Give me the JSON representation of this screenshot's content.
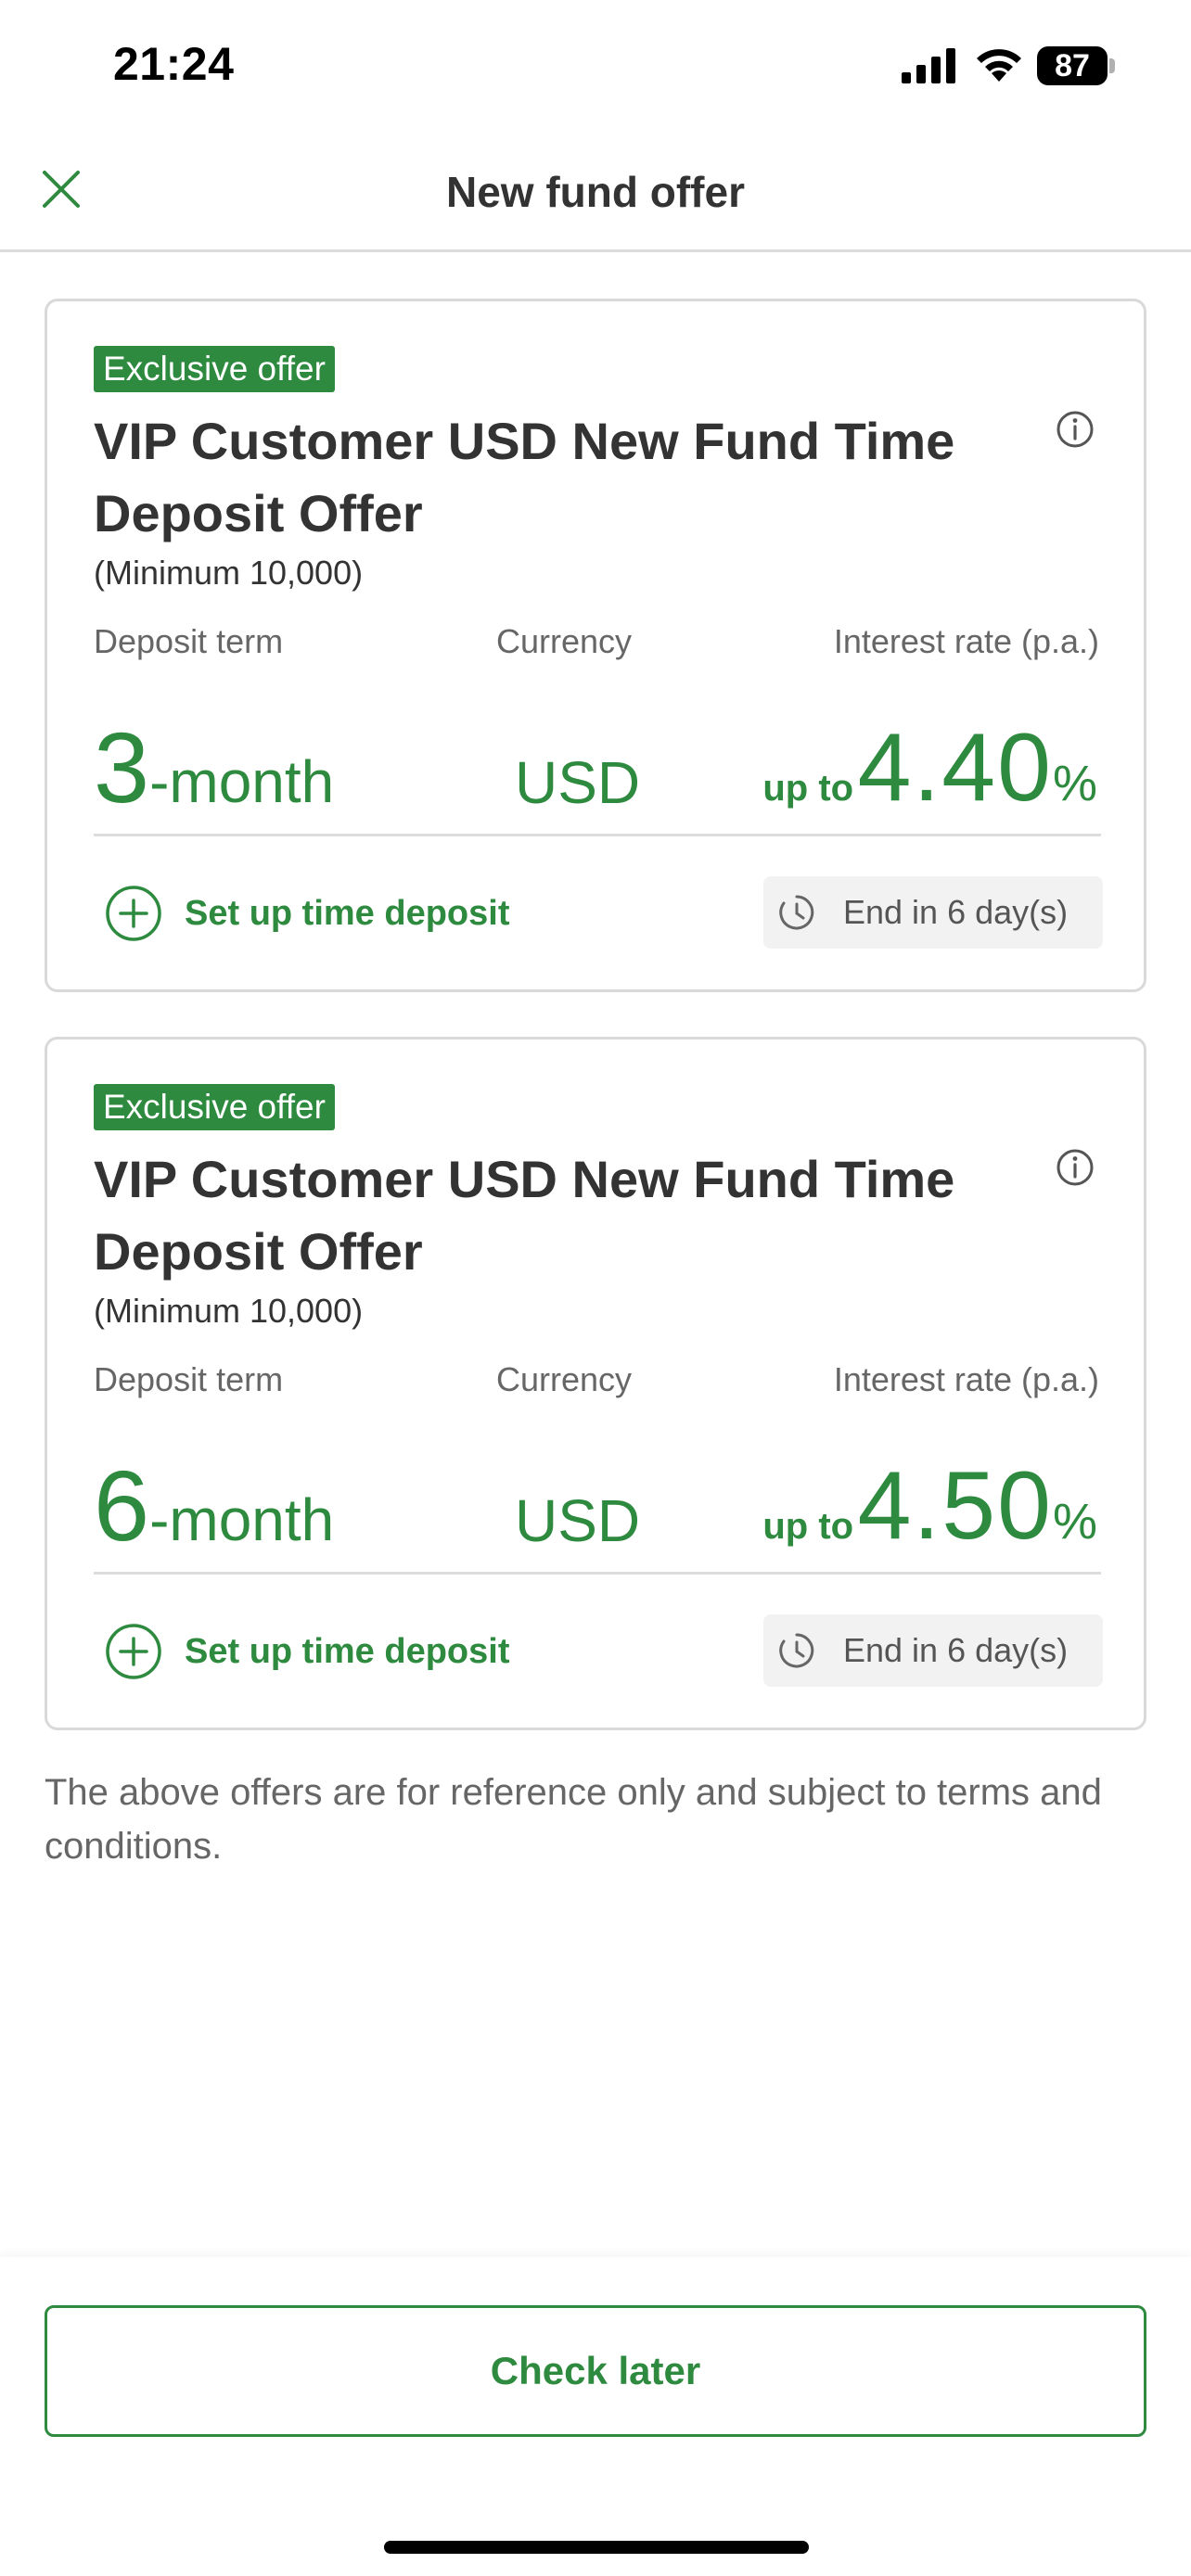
{
  "status_bar": {
    "time": "21:24",
    "battery": "87",
    "icons": [
      "signal-icon",
      "wifi-icon",
      "battery-icon"
    ]
  },
  "header": {
    "title": "New fund offer",
    "close_icon": "close-icon"
  },
  "offers": [
    {
      "badge": "Exclusive offer",
      "title": "VIP Customer USD New Fund Time Deposit Offer",
      "minimum": "(Minimum 10,000)",
      "labels": {
        "term": "Deposit term",
        "currency": "Currency",
        "rate": "Interest rate (p.a.)"
      },
      "term_number": "3",
      "term_unit": "-month",
      "currency": "USD",
      "rate_prefix": "up to",
      "rate": "4.40",
      "rate_suffix": "%",
      "action": "Set up time deposit",
      "end_text": "End in 6 day(s)"
    },
    {
      "badge": "Exclusive offer",
      "title": "VIP Customer USD New Fund Time Deposit Offer",
      "minimum": "(Minimum 10,000)",
      "labels": {
        "term": "Deposit term",
        "currency": "Currency",
        "rate": "Interest rate (p.a.)"
      },
      "term_number": "6",
      "term_unit": "-month",
      "currency": "USD",
      "rate_prefix": "up to",
      "rate": "4.50",
      "rate_suffix": "%",
      "action": "Set up time deposit",
      "end_text": "End in 6 day(s)"
    }
  ],
  "disclaimer": "The above offers are for reference only and subject to terms and conditions.",
  "footer": {
    "check_later_label": "Check later"
  },
  "colors": {
    "accent": "#2d8a3e",
    "text": "#333333",
    "muted": "#666666",
    "border": "#d9d9d9"
  }
}
